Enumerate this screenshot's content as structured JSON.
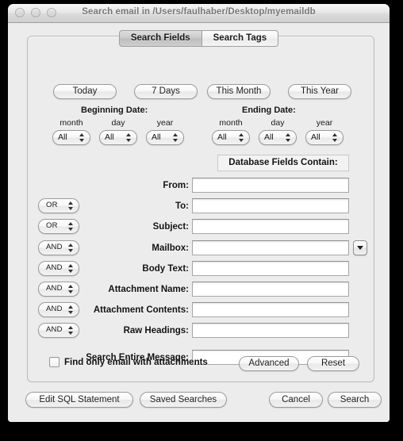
{
  "window": {
    "title": "Search email in /Users/faulhaber/Desktop/myemaildb",
    "traffic_lights": [
      "close-button",
      "minimize-button",
      "zoom-button"
    ]
  },
  "tabs": [
    {
      "label": "Search Fields",
      "active": true
    },
    {
      "label": "Search Tags",
      "active": false
    }
  ],
  "quick_ranges": [
    {
      "label": "Today"
    },
    {
      "label": "7 Days"
    },
    {
      "label": "This Month"
    },
    {
      "label": "This Year"
    }
  ],
  "date_ranges": [
    {
      "title": "Beginning Date:",
      "fields": [
        {
          "label": "month",
          "value": "All"
        },
        {
          "label": "day",
          "value": "All"
        },
        {
          "label": "year",
          "value": "All"
        }
      ]
    },
    {
      "title": "Ending Date:",
      "fields": [
        {
          "label": "month",
          "value": "All"
        },
        {
          "label": "day",
          "value": "All"
        },
        {
          "label": "year",
          "value": "All"
        }
      ]
    }
  ],
  "db_fields_header": "Database Fields Contain:",
  "search_rows": [
    {
      "label": "From:",
      "value": "",
      "operator": null,
      "dropdown": false
    },
    {
      "label": "To:",
      "value": "",
      "operator": "OR",
      "dropdown": false
    },
    {
      "label": "Subject:",
      "value": "",
      "operator": "OR",
      "dropdown": false
    },
    {
      "label": "Mailbox:",
      "value": "",
      "operator": "AND",
      "dropdown": true
    },
    {
      "label": "Body Text:",
      "value": "",
      "operator": "AND",
      "dropdown": false
    },
    {
      "label": "Attachment Name:",
      "value": "",
      "operator": "AND",
      "dropdown": false
    },
    {
      "label": "Attachment Contents:",
      "value": "",
      "operator": "AND",
      "dropdown": false
    },
    {
      "label": "Raw Headings:",
      "value": "",
      "operator": "AND",
      "dropdown": false
    },
    {
      "label": "Search Entire Message:",
      "value": "",
      "operator": null,
      "dropdown": false
    }
  ],
  "attachments_checkbox": {
    "label": "Find only email with attachments",
    "checked": false
  },
  "panel_buttons": [
    {
      "label": "Advanced"
    },
    {
      "label": "Reset"
    }
  ],
  "bottom_buttons": [
    {
      "label": "Edit SQL Statement"
    },
    {
      "label": "Saved Searches"
    },
    {
      "label": "Cancel"
    },
    {
      "label": "Search"
    }
  ]
}
